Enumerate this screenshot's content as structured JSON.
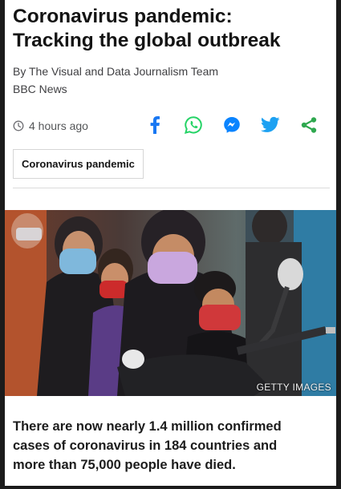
{
  "article": {
    "headline_lines": [
      "Coronavirus pandemic:",
      "Tracking the global outbreak"
    ],
    "byline": "By The Visual and Data Journalism Team",
    "source": "BBC News",
    "timestamp": "4 hours ago",
    "share_icons": [
      "facebook-icon",
      "whatsapp-icon",
      "messenger-icon",
      "twitter-icon",
      "share-icon"
    ],
    "topic_tag": "Coronavirus pandemic",
    "image_credit": "GETTY IMAGES",
    "summary_lines": [
      "There are now nearly 1.4 million confirmed",
      "cases of coronavirus in 184 countries and",
      "more than 75,000 people have died."
    ]
  },
  "colors": {
    "facebook": "#1877f2",
    "whatsapp": "#25d366",
    "messenger": "#0a84ff",
    "twitter": "#1da1f2",
    "share": "#2fa84f"
  }
}
